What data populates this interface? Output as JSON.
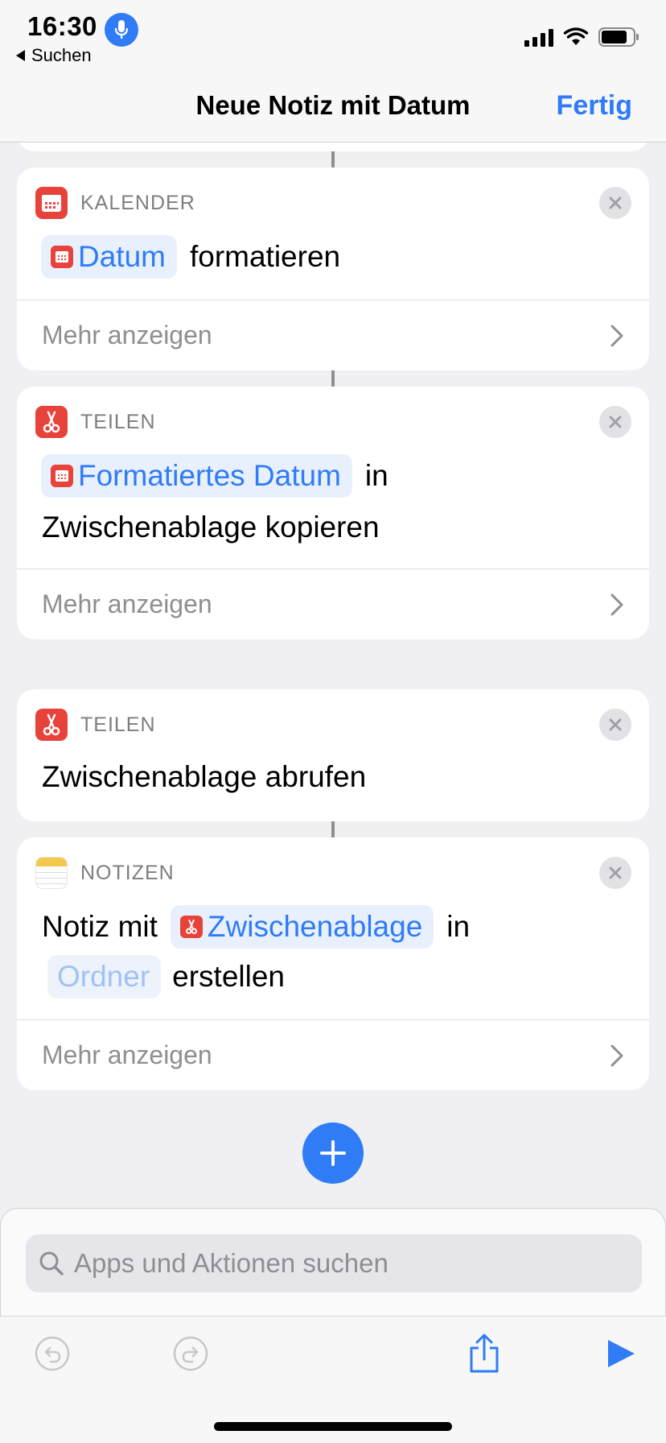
{
  "status": {
    "time": "16:30",
    "back_app": "Suchen"
  },
  "nav": {
    "title": "Neue Notiz mit Datum",
    "done": "Fertig"
  },
  "actions": [
    {
      "app": "KALENDER",
      "token": "Datum",
      "text": "formatieren",
      "more": "Mehr anzeigen"
    },
    {
      "app": "TEILEN",
      "token": "Formatiertes Datum",
      "text1": "in",
      "text2": "Zwischenablage kopieren",
      "more": "Mehr anzeigen"
    },
    {
      "app": "TEILEN",
      "text": "Zwischenablage abrufen"
    },
    {
      "app": "NOTIZEN",
      "prefix": "Notiz mit",
      "token": "Zwischenablage",
      "mid": "in",
      "token2": "Ordner",
      "suffix": "erstellen",
      "more": "Mehr anzeigen"
    }
  ],
  "search": {
    "placeholder": "Apps und Aktionen suchen"
  },
  "colors": {
    "accent": "#2f7cf6",
    "calendar": "#e8433b",
    "share": "#e8433b",
    "notes": "#f5c84b"
  }
}
